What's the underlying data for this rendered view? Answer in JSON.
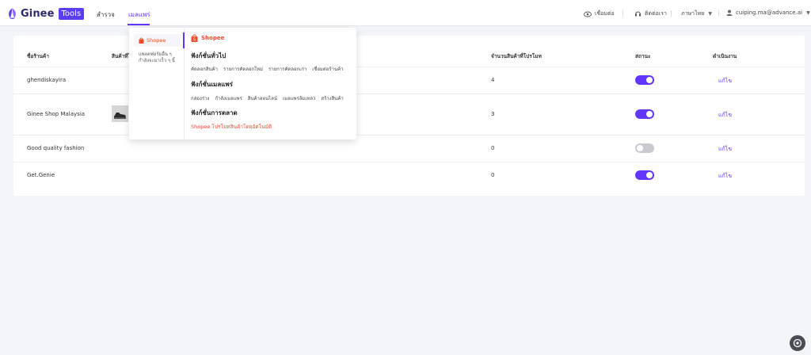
{
  "brand": {
    "name": "Ginee",
    "badge": "Tools"
  },
  "nav": [
    {
      "label": "สำรวจ"
    },
    {
      "label": "เมลแพร่"
    }
  ],
  "top_right": {
    "connect": "เชื่อมต่อ",
    "contact": "ติดต่อเรา",
    "language": "ภาษาไทย",
    "user": "cuiping.ma@advance.ai"
  },
  "table": {
    "headers": [
      "ชื่อร้านค้า",
      "สินค้าที่โ",
      "จำนวนสินค้าที่โปรโมท",
      "สถานะ",
      "ดำเนินงาน"
    ],
    "rows": [
      {
        "shop": "ghendiskayira",
        "count": "4",
        "status_on": true,
        "action": "แก้ไข"
      },
      {
        "shop": "Ginee Shop Malaysia",
        "count": "3",
        "status_on": true,
        "action": "แก้ไข"
      },
      {
        "shop": "Good quality fashion",
        "count": "0",
        "status_on": false,
        "action": "แก้ไข"
      },
      {
        "shop": "Get.Genie",
        "count": "0",
        "status_on": true,
        "action": "แก้ไข"
      }
    ]
  },
  "dropdown": {
    "left_item": "Shopee",
    "left_note": "แพลตฟอร์มอื่น ๆ กำลังจะมาเร็ว ๆ นี้",
    "shop_title": "Shopee",
    "section1": {
      "title": "ฟังก์ชั่นทั่วไป",
      "links": [
        "คัดลอกสินค้า",
        "รายการคัดลอกใหม่",
        "รายการคัดลอกเก่า",
        "เชื่อมต่อร้านค้า"
      ]
    },
    "section2": {
      "title": "ฟังก์ชั่นเมลแพร่",
      "links": [
        "กล่องร่าง",
        "กำลังเมลแพร่",
        "สินค้าออนไลน์",
        "เมลแพร่ล้มเหลว",
        "สร้างสินค้า"
      ]
    },
    "section3": {
      "title": "ฟังก์ชั่นการตลาด",
      "promo": "Shopee โปรโมทสินค้าโดยอัตโนมัติ"
    }
  },
  "colors": {
    "accent": "#6236ff",
    "shopee": "#ee4d2d",
    "toggle_off": "#c9c9d0"
  }
}
